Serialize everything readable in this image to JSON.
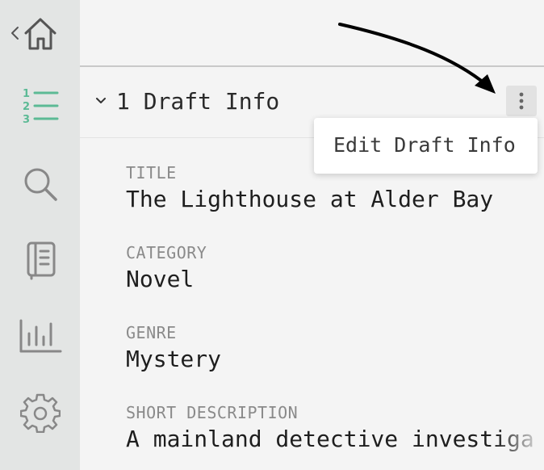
{
  "sidebar": {
    "items": [
      {
        "name": "home-icon",
        "label": "Home"
      },
      {
        "name": "outline-list-icon",
        "label": "Outline"
      },
      {
        "name": "search-icon",
        "label": "Search"
      },
      {
        "name": "notebook-icon",
        "label": "Notebook"
      },
      {
        "name": "stats-chart-icon",
        "label": "Statistics"
      },
      {
        "name": "gear-icon",
        "label": "Settings"
      }
    ],
    "active_item": "outline-list-icon",
    "active_color": "#5cba95"
  },
  "section": {
    "title": "1 Draft Info",
    "expanded": true
  },
  "menu": {
    "items": [
      "Edit Draft Info"
    ]
  },
  "fields": [
    {
      "label": "TITLE",
      "value": "The Lighthouse at Alder Bay"
    },
    {
      "label": "CATEGORY",
      "value": "Novel"
    },
    {
      "label": "GENRE",
      "value": "Mystery"
    },
    {
      "label": "SHORT DESCRIPTION",
      "value": "A mainland detective investiga"
    }
  ]
}
